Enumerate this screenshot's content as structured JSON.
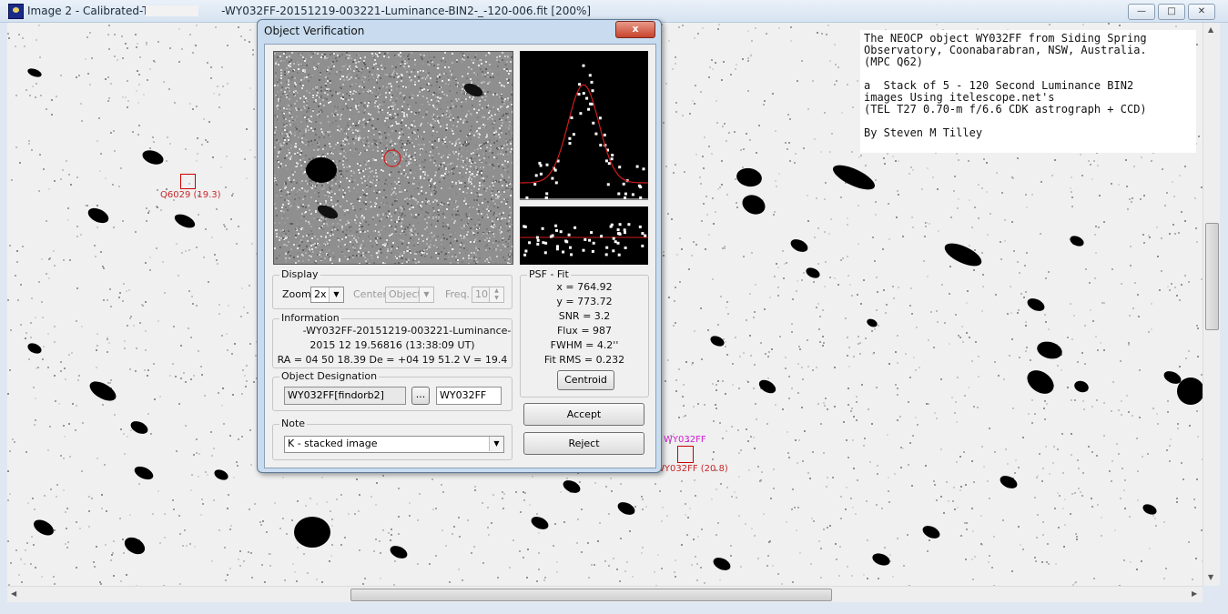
{
  "window": {
    "title": "Image 2 - Calibrated-T27-",
    "title_rest": "-WY032FF-20151219-003221-Luminance-BIN2-_-120-006.fit [200%]",
    "minimize_icon": "minimize-icon",
    "maximize_icon": "maximize-icon",
    "close_icon": "close-icon"
  },
  "annotation": {
    "text": "The NEOCP object WY032FF from Siding Spring\nObservatory, Coonabarabran, NSW, Australia.\n(MPC Q62)\n\na  Stack of 5 - 120 Second Luminance BIN2\nimages Using itelescope.net's\n(TEL T27 0.70-m f/6.6 CDK astrograph + CCD)\n\nBy Steven M Tilley"
  },
  "markers": {
    "known_label": "Q6029 (19.3)",
    "target_label_top": "WY032FF",
    "target_label_bottom": "WY032FF (20.8)"
  },
  "dialog": {
    "title": "Object Verification",
    "close_label": "x",
    "display": {
      "group_label": "Display",
      "zoom_label": "Zoom",
      "zoom_value": "2x",
      "center_label": "Center",
      "center_value": "Object",
      "freq_label": "Freq.",
      "freq_value": "10"
    },
    "information": {
      "group_label": "Information",
      "line1": "-WY032FF-20151219-003221-Luminance-",
      "line2": "2015 12 19.56816 (13:38:09 UT)",
      "line3": "RA = 04 50 18.39   De = +04 19 51.2   V = 19.4"
    },
    "designation": {
      "group_label": "Object Designation",
      "findorb_value": "WY032FF[findorb2]",
      "browse_label": "...",
      "name_value": "WY032FF"
    },
    "note": {
      "group_label": "Note",
      "value": "K - stacked image"
    },
    "psf": {
      "group_label": "PSF - Fit",
      "x": "x = 764.92",
      "y": "y = 773.72",
      "snr": "SNR = 3.2",
      "flux": "Flux = 987",
      "fwhm": "FWHM = 4.2''",
      "fitrms": "Fit RMS = 0.232",
      "centroid_label": "Centroid"
    },
    "accept_label": "Accept",
    "reject_label": "Reject"
  },
  "colors": {
    "marker_red": "#c8282a",
    "marker_magenta": "#d01cd0",
    "psf_curve": "#d11b1b"
  }
}
